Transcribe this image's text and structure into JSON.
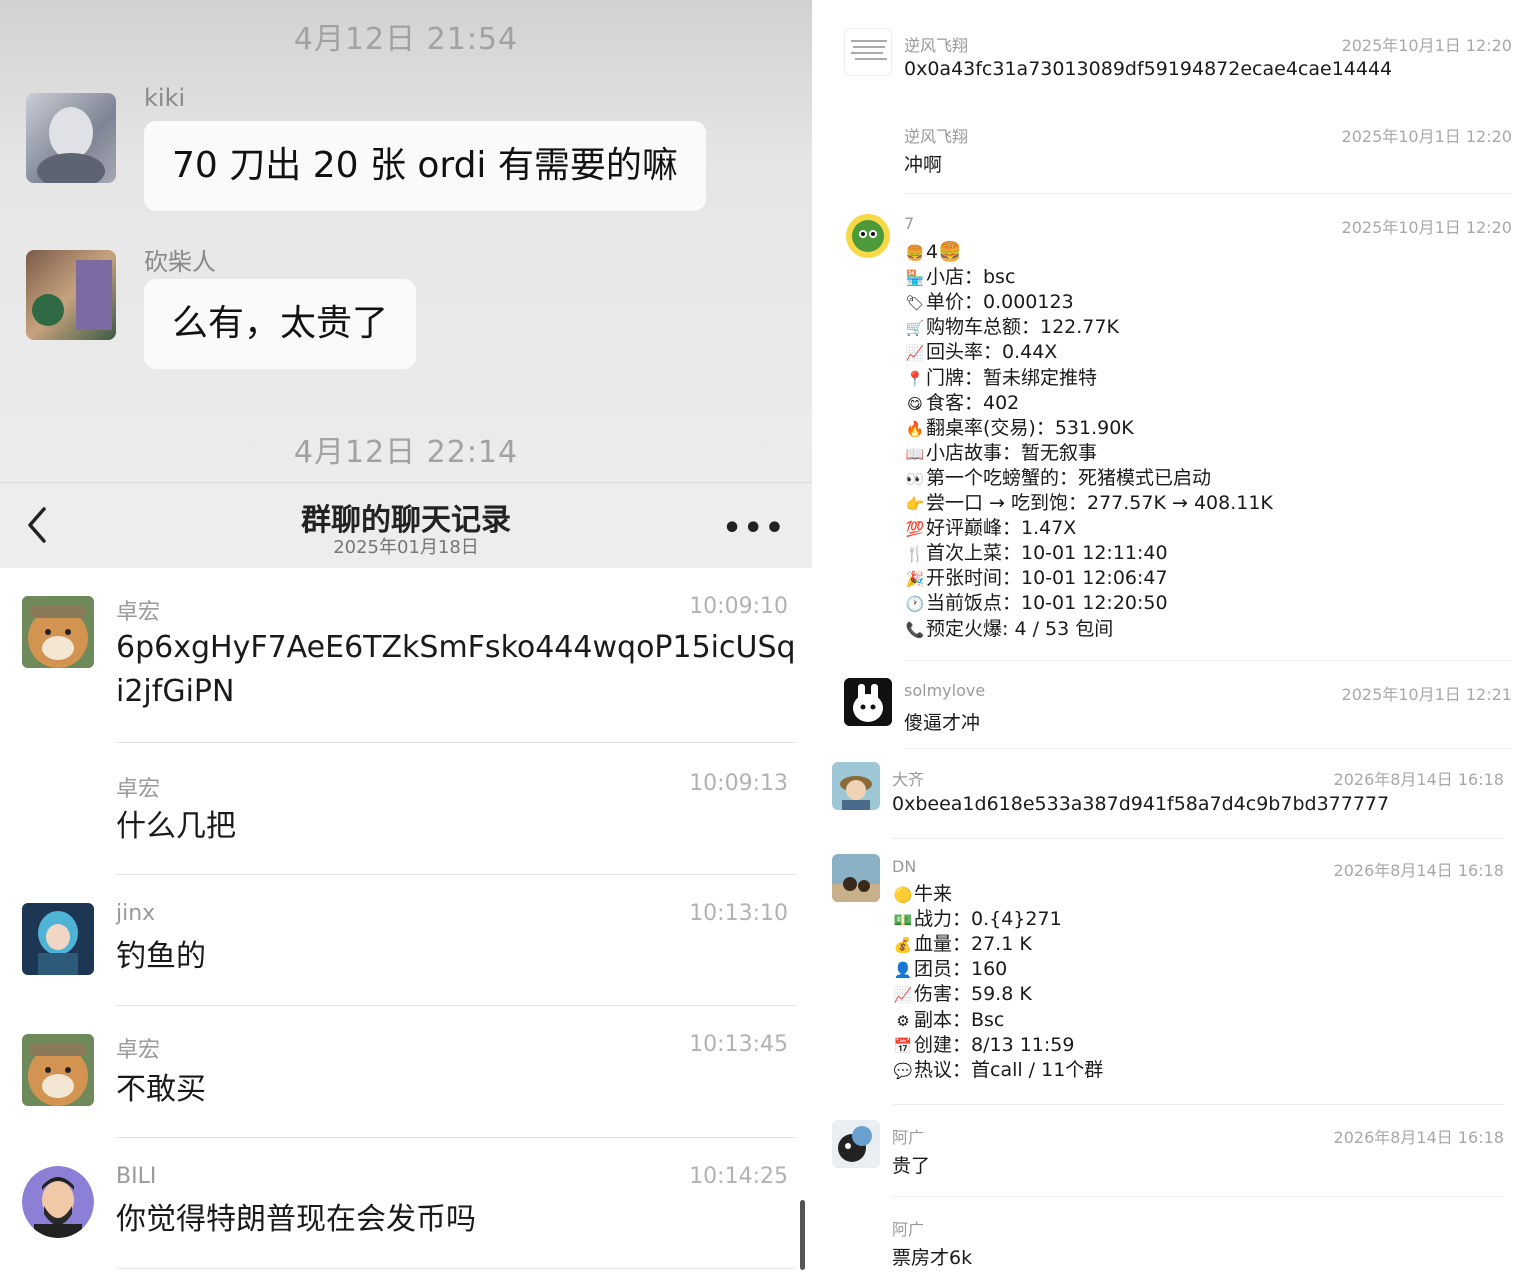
{
  "top_chat": {
    "timestamp_1": "4月12日 21:54",
    "messages": [
      {
        "name": "kiki",
        "text": "70 刀出 20 张 ordi 有需要的嘛"
      },
      {
        "name": "砍柴人",
        "text": "么有，太贵了"
      }
    ],
    "timestamp_2": "4月12日 22:14"
  },
  "history": {
    "title": "群聊的聊天记录",
    "subtitle": "2025年01月18日",
    "back_icon": "chevron-left-icon",
    "more_icon": "more-dots-icon",
    "more_label": "•••",
    "items": [
      {
        "name": "卓宏",
        "time": "10:09:10",
        "text": "6p6xgHyF7AeE6TZkSmFsko444wqoP15icUSqi2jfGiPN",
        "avatar": "shiba"
      },
      {
        "name": "卓宏",
        "time": "10:09:13",
        "text": "什么几把",
        "avatar": ""
      },
      {
        "name": "jinx",
        "time": "10:13:10",
        "text": "钓鱼的",
        "avatar": "jinx"
      },
      {
        "name": "卓宏",
        "time": "10:13:45",
        "text": "不敢买",
        "avatar": "shiba"
      },
      {
        "name": "BILI",
        "time": "10:14:25",
        "text": "你觉得特朗普现在会发币吗",
        "avatar": "bili"
      }
    ]
  },
  "right_chat": {
    "messages": [
      {
        "name": "逆风飞翔",
        "time": "2025年10月1日 12:20",
        "text": "0x0a43fc31a73013089df59194872ecae4cae14444"
      },
      {
        "name": "逆风飞翔",
        "time": "2025年10月1日 12:20",
        "text": "冲啊"
      },
      {
        "name": "7",
        "time": "2025年10月1日 12:20"
      },
      {
        "name": "solmylove",
        "time": "2025年10月1日 12:21",
        "text": "傻逼才冲"
      },
      {
        "name": "大齐",
        "time": "2026年8月14日 16:18",
        "text": "0xbeea1d618e533a387d941f58a7d4c9b7bd377777"
      },
      {
        "name": "DN",
        "time": "2026年8月14日 16:18"
      },
      {
        "name": "阿广",
        "time": "2026年8月14日 16:18",
        "text": "贵了"
      },
      {
        "name": "阿广",
        "text": "票房才6k"
      }
    ],
    "bot_7": [
      {
        "icon": "🍔",
        "text": "4🍔"
      },
      {
        "icon": "🏪",
        "text": "小店：bsc"
      },
      {
        "icon": "🏷",
        "text": "单价：0.000123"
      },
      {
        "icon": "🛒",
        "text": "购物车总额：122.77K"
      },
      {
        "icon": "📈",
        "text": "回头率：0.44X"
      },
      {
        "icon": "📍",
        "text": "门牌：暂未绑定推特"
      },
      {
        "icon": "😋",
        "text": "食客：402"
      },
      {
        "icon": "🔥",
        "text": "翻桌率(交易)：531.90K"
      },
      {
        "icon": "📖",
        "text": "小店故事：暂无叙事"
      },
      {
        "icon": "👀",
        "text": "第一个吃螃蟹的：死猪模式已启动"
      },
      {
        "icon": "👉",
        "text": "尝一口 → 吃到饱：277.57K → 408.11K"
      },
      {
        "icon": "💯",
        "text": "好评巅峰：1.47X"
      },
      {
        "icon": "🍴",
        "text": "首次上菜：10-01 12:11:40"
      },
      {
        "icon": "🎉",
        "text": "开张时间：10-01 12:06:47"
      },
      {
        "icon": "🕐",
        "text": "当前饭点：10-01 12:20:50"
      },
      {
        "icon": "📞",
        "text": "预定火爆: 4 / 53 包间"
      }
    ],
    "bot_dn": [
      {
        "icon": "🟡",
        "text": "牛来"
      },
      {
        "icon": "💵",
        "text": "战力：0.{4}271"
      },
      {
        "icon": "💰",
        "text": "血量：27.1 K"
      },
      {
        "icon": "👤",
        "text": "团员：160"
      },
      {
        "icon": "📈",
        "text": "伤害：59.8 K"
      },
      {
        "icon": "⚙",
        "text": "副本：Bsc"
      },
      {
        "icon": "📅",
        "text": "创建：8/13 11:59"
      },
      {
        "icon": "💬",
        "text": "热议：首call / 11个群"
      }
    ]
  }
}
